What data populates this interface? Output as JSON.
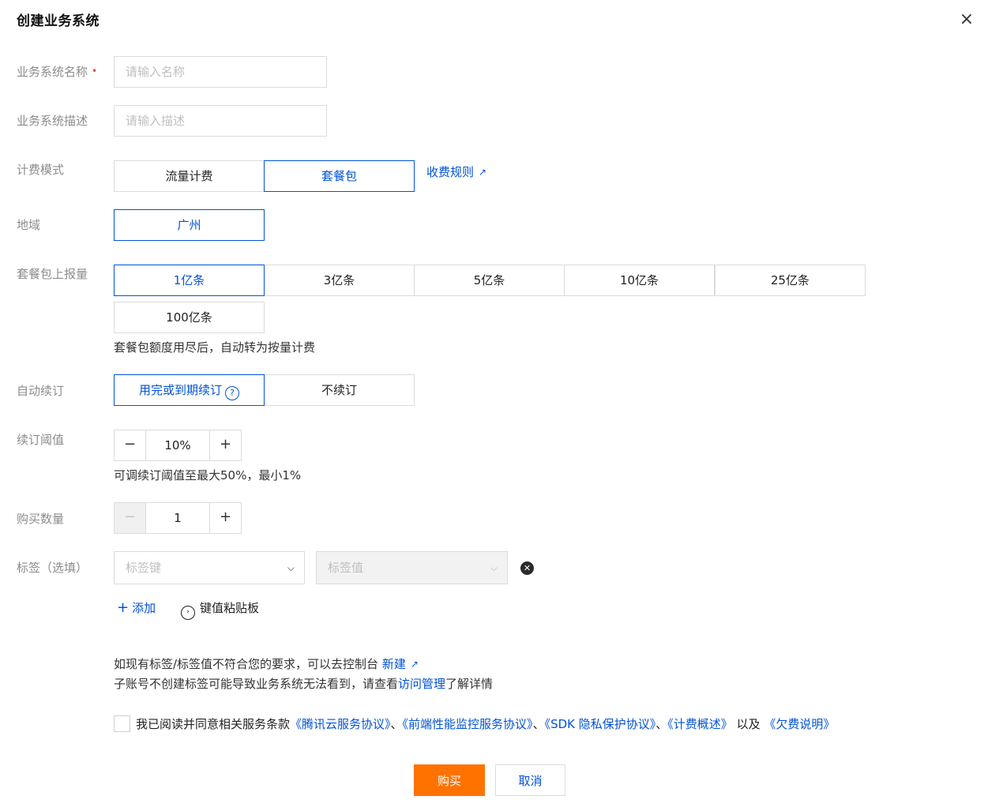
{
  "dialog": {
    "title": "创建业务系统",
    "close_label": "×"
  },
  "form": {
    "name": {
      "label": "业务系统名称",
      "required_mark": "•",
      "placeholder": "请输入名称",
      "value": ""
    },
    "desc": {
      "label": "业务系统描述",
      "placeholder": "请输入描述",
      "value": ""
    },
    "billing": {
      "label": "计费模式",
      "options": [
        "流量计费",
        "套餐包"
      ],
      "selected": "套餐包",
      "rules_link": "收费规则",
      "rules_icon": "external-link-icon"
    },
    "region": {
      "label": "地域",
      "options": [
        "广州"
      ],
      "selected": "广州"
    },
    "package": {
      "label": "套餐包上报量",
      "options": [
        "1亿条",
        "3亿条",
        "5亿条",
        "10亿条",
        "25亿条",
        "100亿条"
      ],
      "selected": "1亿条",
      "hint": "套餐包额度用尽后，自动转为按量计费"
    },
    "renew": {
      "label": "自动续订",
      "options": [
        "用完或到期续订",
        "不续订"
      ],
      "selected": "用完或到期续订",
      "help_icon": "help-circle-icon",
      "help_glyph": "?"
    },
    "threshold": {
      "label": "续订阈值",
      "value": "10%",
      "minus": "−",
      "plus": "+",
      "hint": "可调续订阈值至最大50%，最小1%"
    },
    "quantity": {
      "label": "购买数量",
      "value": "1",
      "minus": "−",
      "plus": "+",
      "minus_disabled": true
    },
    "tags": {
      "label": "标签（选填）",
      "key_placeholder": "标签键",
      "value_placeholder": "标签值",
      "chevron": "⌵",
      "clear_glyph": "✕",
      "add_label": "添加",
      "add_glyph": "+",
      "paste_label": "键值粘贴板",
      "paste_glyph": "›",
      "note_line1": "如现有标签/标签值不符合您的要求，可以去控制台",
      "note_new_link": "新建",
      "note_line2_prefix": "子账号不创建标签可能导致业务系统无法看到，请查看",
      "note_access_link": "访问管理",
      "note_line2_suffix": "了解详情"
    }
  },
  "agreement": {
    "prefix": "我已阅读并同意相关服务条款",
    "links": [
      "《腾讯云服务协议》",
      "《前端性能监控服务协议》",
      "《SDK 隐私保护协议》",
      "《计费概述》",
      "《欠费说明》"
    ],
    "sep": "、",
    "and": "以及",
    "checked": false
  },
  "actions": {
    "buy_label": "购买",
    "cancel_label": "取消"
  },
  "colors": {
    "primary": "#0052d9",
    "buy": "#ff7200",
    "required": "#e54545"
  }
}
